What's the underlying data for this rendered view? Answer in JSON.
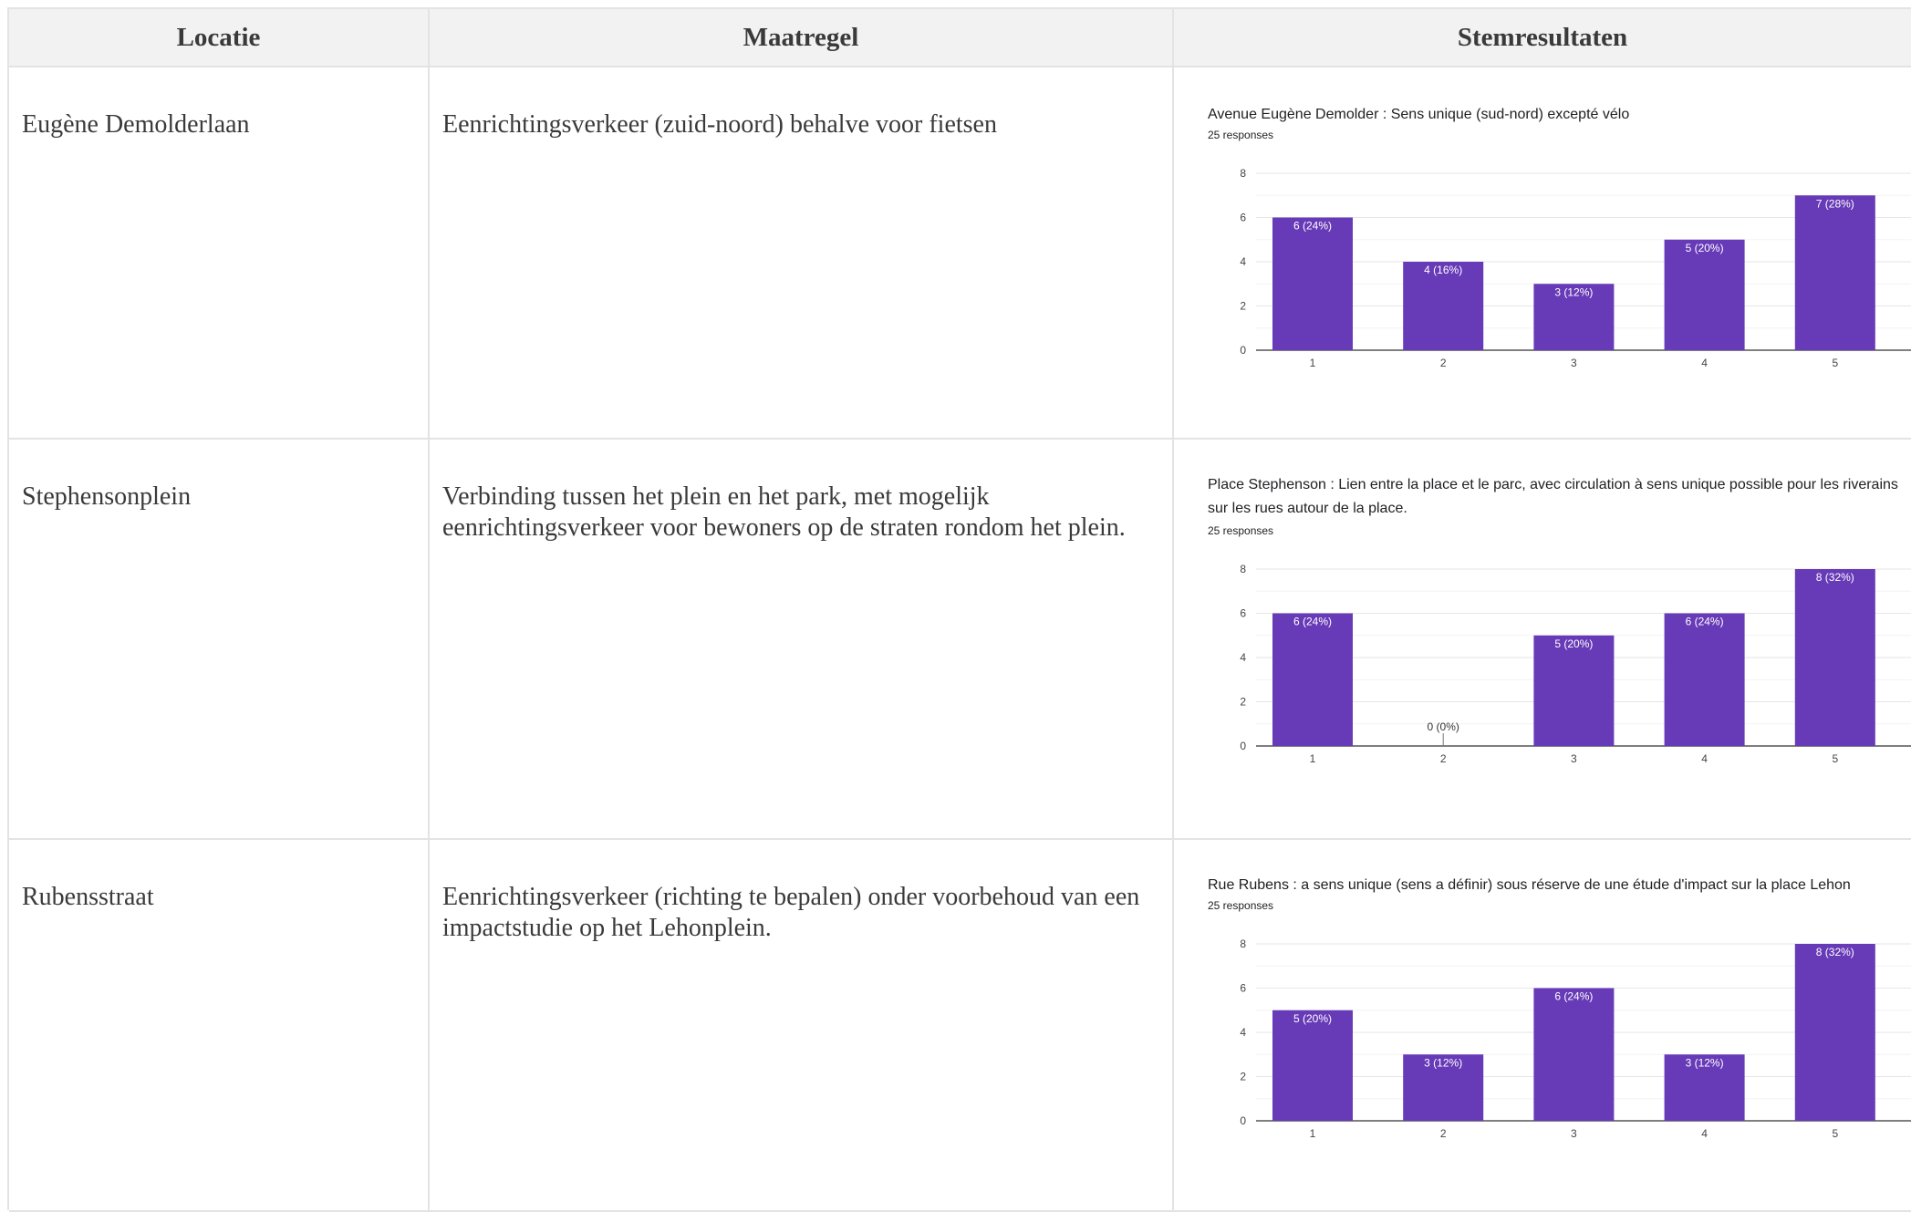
{
  "headers": {
    "locatie": "Locatie",
    "maatregel": "Maatregel",
    "stemresultaten": "Stemresultaten"
  },
  "rows": [
    {
      "locatie": "Eugène Demolderlaan",
      "maatregel": "Eenrichtingsverkeer (zuid-noord) behalve voor fietsen"
    },
    {
      "locatie": "Stephensonplein",
      "maatregel": "Verbinding tussen het plein en het park, met mogelijk eenrichtingsverkeer voor bewoners op de straten rondom het plein."
    },
    {
      "locatie": "Rubensstraat",
      "maatregel": "Eenrichtingsverkeer (richting te bepalen) onder voorbehoud van een impactstudie op het Lehonplein."
    }
  ],
  "bar_color": "#673ab7",
  "chart_data": [
    {
      "type": "bar",
      "title": "Avenue Eugène Demolder : Sens unique (sud-nord) excepté vélo",
      "subtitle": "25 responses",
      "categories": [
        "1",
        "2",
        "3",
        "4",
        "5"
      ],
      "values": [
        6,
        4,
        3,
        5,
        7
      ],
      "labels": [
        "6 (24%)",
        "4 (16%)",
        "3 (12%)",
        "5 (20%)",
        "7 (28%)"
      ],
      "yticks": [
        "0",
        "2",
        "4",
        "6",
        "8"
      ],
      "ylim": [
        0,
        8
      ]
    },
    {
      "type": "bar",
      "title": "Place Stephenson : Lien entre la place et le parc, avec circulation à sens unique possible pour les riverains sur les rues autour de la place.",
      "subtitle": "25 responses",
      "categories": [
        "1",
        "2",
        "3",
        "4",
        "5"
      ],
      "values": [
        6,
        0,
        5,
        6,
        8
      ],
      "labels": [
        "6 (24%)",
        "0 (0%)",
        "5 (20%)",
        "6 (24%)",
        "8 (32%)"
      ],
      "yticks": [
        "0",
        "2",
        "4",
        "6",
        "8"
      ],
      "ylim": [
        0,
        8
      ]
    },
    {
      "type": "bar",
      "title": "Rue Rubens : a sens unique (sens a définir) sous réserve de une étude d'impact sur la place Lehon",
      "subtitle": "25 responses",
      "categories": [
        "1",
        "2",
        "3",
        "4",
        "5"
      ],
      "values": [
        5,
        3,
        6,
        3,
        8
      ],
      "labels": [
        "5 (20%)",
        "3 (12%)",
        "6 (24%)",
        "3 (12%)",
        "8 (32%)"
      ],
      "yticks": [
        "0",
        "2",
        "4",
        "6",
        "8"
      ],
      "ylim": [
        0,
        8
      ]
    }
  ]
}
